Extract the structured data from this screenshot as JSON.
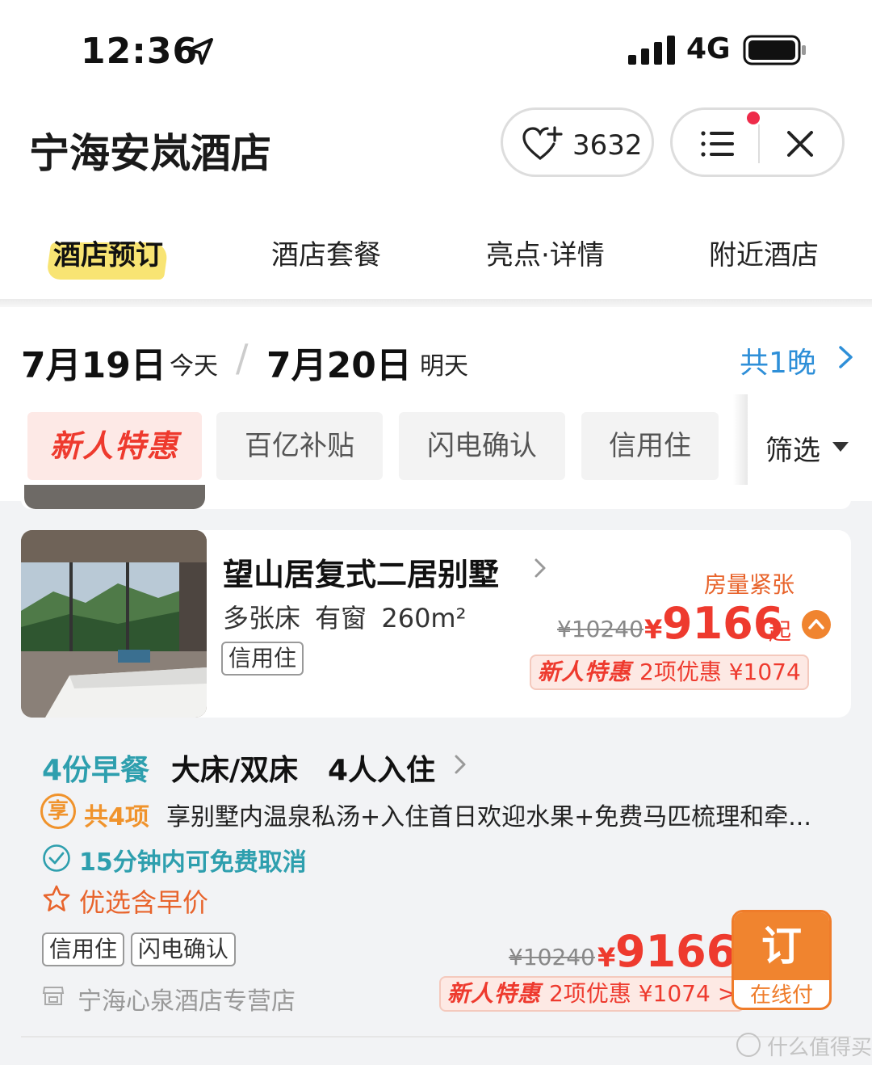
{
  "status_bar": {
    "time": "12:36",
    "network": "4G"
  },
  "header": {
    "title": "宁海安岚酒店",
    "favorite_count": "3632"
  },
  "tabs": [
    {
      "label": "酒店预订",
      "active": true
    },
    {
      "label": "酒店套餐",
      "active": false
    },
    {
      "label": "亮点·详情",
      "active": false
    },
    {
      "label": "附近酒店",
      "active": false
    }
  ],
  "dates": {
    "checkin": "7月19日",
    "checkin_label": "今天",
    "separator": "/",
    "checkout": "7月20日",
    "checkout_label": "明天",
    "nights": "共1晚"
  },
  "filters": {
    "chips": [
      "新人特惠",
      "百亿补贴",
      "闪电确认",
      "信用住"
    ],
    "filter_label": "筛选"
  },
  "room": {
    "name": "望山居复式二居别墅",
    "specs": "多张床  有窗  260m²",
    "tag": "信用住",
    "scarcity": "房量紧张",
    "original_price": "¥10240",
    "currency": "¥",
    "price": "9166",
    "suffix": "起",
    "discount_logo": "新人特惠",
    "discount_text": "2项优惠 ¥1074"
  },
  "rate_plan": {
    "meal": "4份早餐",
    "bed": "大床/双床",
    "occupancy": "4人入住",
    "perk_icon": "享",
    "perk_count": "共4项",
    "perk_text": "享别墅内温泉私汤+入住首日欢迎水果+免费马匹梳理和牵...",
    "cancel_text": "15分钟内可免费取消",
    "badge_text": "优选含早价",
    "tags": [
      "信用住",
      "闪电确认"
    ],
    "seller": "宁海心泉酒店专营店",
    "original_price": "¥10240",
    "currency": "¥",
    "price": "9166",
    "discount_logo": "新人特惠",
    "discount_text": "2项优惠 ¥1074 >",
    "book_label": "订",
    "pay_label": "在线付"
  },
  "watermark": "什么值得买",
  "colors": {
    "accent_red": "#ee3a2e",
    "accent_orange": "#f0842f",
    "teal": "#2e9fae",
    "link_blue": "#2e8fd8",
    "tab_highlight": "#f7df5a"
  }
}
